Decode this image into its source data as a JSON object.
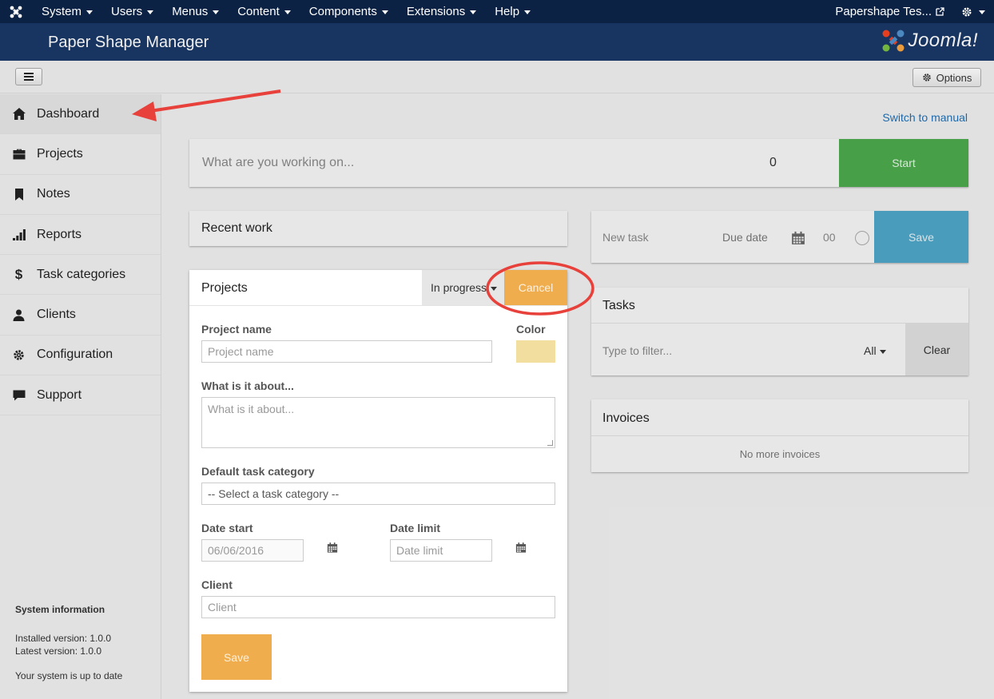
{
  "topnav": {
    "menu": [
      {
        "label": "System"
      },
      {
        "label": "Users"
      },
      {
        "label": "Menus"
      },
      {
        "label": "Content"
      },
      {
        "label": "Components"
      },
      {
        "label": "Extensions"
      },
      {
        "label": "Help"
      }
    ],
    "site_name": "Papershape Tes..."
  },
  "header": {
    "title": "Paper Shape Manager",
    "brand": "Joomla!"
  },
  "toolbar": {
    "options_label": "Options"
  },
  "sidebar": {
    "items": [
      {
        "label": "Dashboard",
        "icon": "home-icon"
      },
      {
        "label": "Projects",
        "icon": "briefcase-icon"
      },
      {
        "label": "Notes",
        "icon": "bookmark-icon"
      },
      {
        "label": "Reports",
        "icon": "signal-icon"
      },
      {
        "label": "Task categories",
        "icon": "dollar-icon"
      },
      {
        "label": "Clients",
        "icon": "user-icon"
      },
      {
        "label": "Configuration",
        "icon": "cog-icon"
      },
      {
        "label": "Support",
        "icon": "comment-icon"
      }
    ],
    "system_info": {
      "heading": "System information",
      "installed": "Installed version: 1.0.0",
      "latest": "Latest version: 1.0.0",
      "status": "Your system is up to date"
    }
  },
  "main": {
    "switch_link": "Switch to manual",
    "work": {
      "placeholder": "What are you working on...",
      "counter": "0",
      "start_label": "Start"
    },
    "recent_work": {
      "title": "Recent work"
    },
    "new_task": {
      "placeholder": "New task",
      "due_date": "Due date",
      "hours": "00",
      "save_label": "Save"
    },
    "tasks": {
      "title": "Tasks",
      "filter_placeholder": "Type to filter...",
      "filter_select": "All",
      "clear_label": "Clear"
    },
    "invoices": {
      "title": "Invoices",
      "empty_text": "No more invoices"
    },
    "projects_form": {
      "title": "Projects",
      "status": "In progress",
      "cancel_label": "Cancel",
      "project_name_label": "Project name",
      "project_name_placeholder": "Project name",
      "color_label": "Color",
      "color_value": "#f2dfa0",
      "about_label": "What is it about...",
      "about_placeholder": "What is it about...",
      "category_label": "Default task category",
      "category_value": "-- Select a task category --",
      "date_start_label": "Date start",
      "date_start_value": "06/06/2016",
      "date_limit_label": "Date limit",
      "date_limit_placeholder": "Date limit",
      "client_label": "Client",
      "client_placeholder": "Client",
      "save_label": "Save"
    }
  },
  "colors": {
    "topnav_bg": "#0b2245",
    "header_bg": "#1a3867",
    "start_green": "#4caa4c",
    "save_blue": "#4ea6c7",
    "orange": "#f0ad4e",
    "annotation_red": "#e8403a"
  }
}
